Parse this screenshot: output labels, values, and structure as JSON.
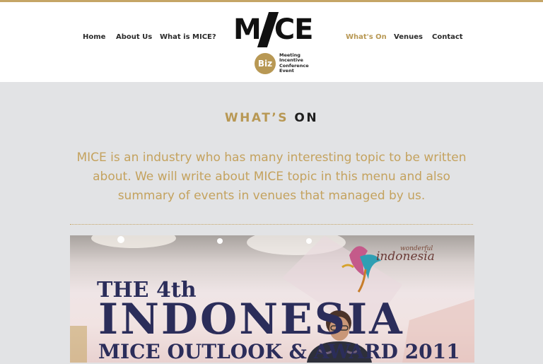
{
  "nav": {
    "left": [
      "Home",
      "About Us",
      "What is MICE?"
    ],
    "right": [
      "What's On",
      "Venues",
      "Contact"
    ],
    "active": "What's On"
  },
  "logo": {
    "word_left": "M",
    "word_right": "CE",
    "badge": "Biz",
    "tagline": [
      "Meeting",
      "Incentive",
      "Conference",
      "Event"
    ]
  },
  "section": {
    "title_part1": "WHAT’S",
    "title_part2": "ON",
    "intro": "MICE is an industry who has many interesting topic to be written about. We will write about MICE topic in this menu and also summary of events in venues that managed by us."
  },
  "photo": {
    "banner_line1": "THE 4th",
    "banner_line2": "INDONESIA",
    "banner_line3": "MICE OUTLOOK & AWARD 2011",
    "brand_small": "wonderful",
    "brand_big": "indonesia"
  },
  "colors": {
    "accent_gold": "#b89854",
    "background": "#e2e3e5",
    "header_bg": "#ffffff",
    "nav_text": "#2a2a2a"
  }
}
